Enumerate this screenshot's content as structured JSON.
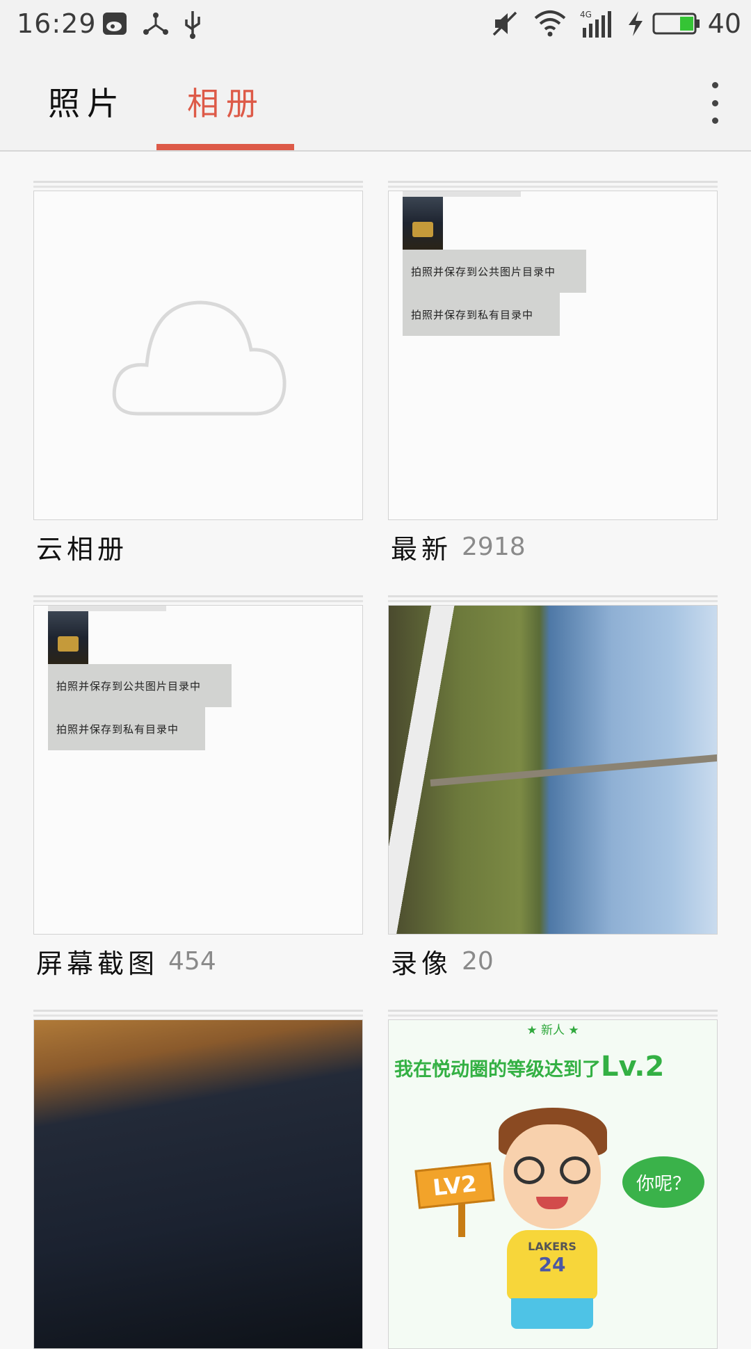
{
  "status_bar": {
    "time": "16:29",
    "battery_level": "40",
    "icons": [
      "weibo-icon",
      "share-nodes-icon",
      "usb-icon",
      "mute-icon",
      "wifi-icon",
      "signal-4g-icon",
      "charging-icon",
      "battery-icon"
    ]
  },
  "tabs": [
    {
      "label": "照片",
      "active": false
    },
    {
      "label": "相册",
      "active": true
    }
  ],
  "accent_color": "#dd5a48",
  "albums": [
    {
      "name": "云相册",
      "count": ""
    },
    {
      "name": "最新",
      "count": "2918",
      "menu": [
        "拍照并保存到公共图片目录中",
        "拍照并保存到私有目录中"
      ]
    },
    {
      "name": "屏幕截图",
      "count": "454",
      "menu": [
        "拍照并保存到公共图片目录中",
        "拍照并保存到私有目录中"
      ]
    },
    {
      "name": "录像",
      "count": "20"
    },
    {
      "name": "",
      "count": ""
    },
    {
      "name": "",
      "count": "",
      "promo": {
        "top": "★ 新人 ★",
        "headline": "我在悦动圈的等级达到了",
        "level": "Lv.2",
        "sign": "LV2",
        "bubble": "你呢？",
        "shirt_text": "LAKERS",
        "shirt_number": "24"
      }
    }
  ]
}
